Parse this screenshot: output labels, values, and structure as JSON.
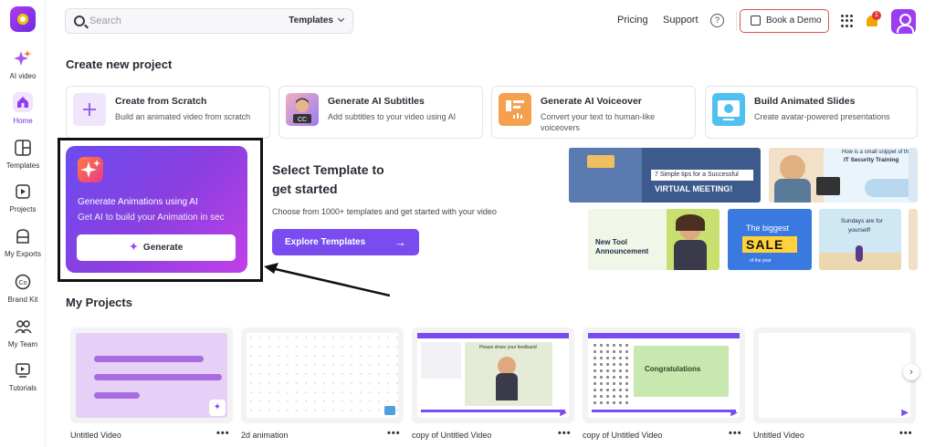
{
  "sidebar": {
    "items": [
      {
        "label": "AI video"
      },
      {
        "label": "Home"
      },
      {
        "label": "Templates"
      },
      {
        "label": "Projects"
      },
      {
        "label": "My Exports"
      },
      {
        "label": "Brand Kit"
      },
      {
        "label": "My Team"
      },
      {
        "label": "Tutorials"
      }
    ],
    "active": "Home"
  },
  "header": {
    "search_placeholder": "Search",
    "search_scope": "Templates",
    "pricing": "Pricing",
    "support": "Support",
    "help": "?",
    "book_demo": "Book a Demo",
    "notification_count": "1"
  },
  "create": {
    "heading": "Create new project",
    "cards": [
      {
        "title": "Create from Scratch",
        "desc": "Build an animated video from scratch",
        "icon": "plus-icon"
      },
      {
        "title": "Generate AI Subtitles",
        "desc": "Add subtitles to your video using AI",
        "icon": "cc-icon"
      },
      {
        "title": "Generate AI Voiceover",
        "desc": "Convert your text to human-like voiceovers",
        "icon": "voiceover-icon"
      },
      {
        "title": "Build Animated Slides",
        "desc": "Create avatar-powered presentations",
        "icon": "slides-icon"
      }
    ]
  },
  "ai_card": {
    "title": "Generate Animations using AI",
    "subtitle": "Get AI to build your Animation in sec",
    "button": "Generate"
  },
  "templates_promo": {
    "title_line1": "Select Template to",
    "title_line2": "get started",
    "desc": "Choose from 1000+ templates and get started with your video",
    "button": "Explore Templates",
    "thumbs": {
      "virtual_meeting_1": "7 Simple tips for a Successful",
      "virtual_meeting_2": "VIRTUAL MEETING!",
      "security_1": "How is a small snippet of the",
      "security_2": "IT Security Training",
      "tool_1": "New Tool",
      "tool_2": "Announcement",
      "sale_1": "The biggest",
      "sale_2": "SALE",
      "sale_3": "of the year",
      "sundays_1": "Sundays are for",
      "sundays_2": "yourself!",
      "cc": "CC"
    }
  },
  "projects": {
    "heading": "My Projects",
    "items": [
      {
        "name": "Untitled Video"
      },
      {
        "name": "2d animation"
      },
      {
        "name": "copy of Untitled Video",
        "thumb_text": "Please share your feedback!"
      },
      {
        "name": "copy of Untitled Video",
        "thumb_text": "Congratulations"
      },
      {
        "name": "Untitled Video"
      }
    ],
    "more": "•••",
    "next": "›"
  },
  "colors": {
    "accent": "#7a4cf0",
    "brand": "#9b3df0",
    "demo_border": "#e0504e"
  }
}
